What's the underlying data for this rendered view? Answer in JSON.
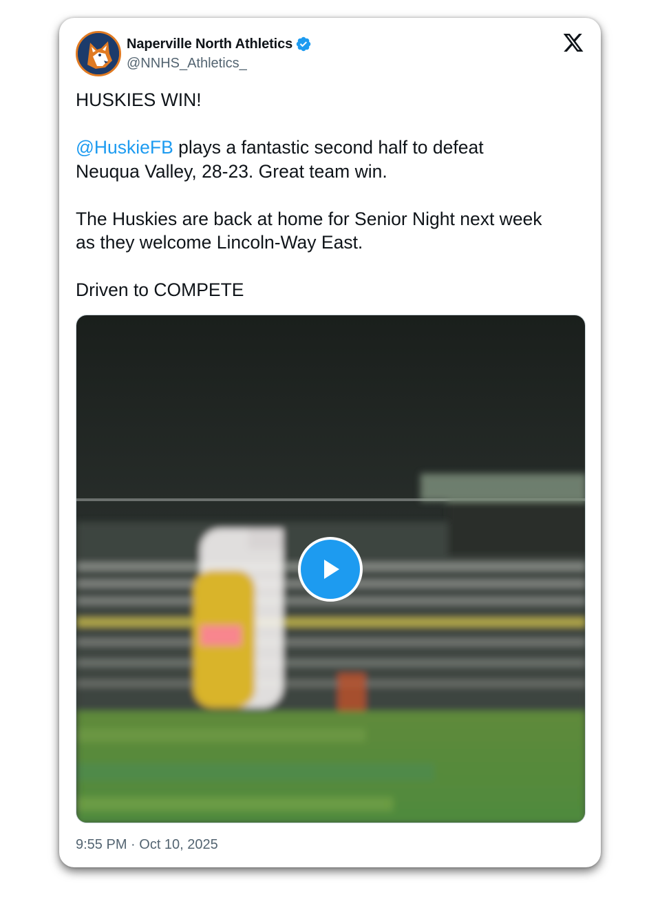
{
  "tweet": {
    "author": {
      "display_name": "Naperville North Athletics",
      "handle": "@NNHS_Athletics_",
      "verified": true,
      "avatar_icon": "husky-logo-icon"
    },
    "platform_icon": "x-logo-icon",
    "text": {
      "line1": "HUSKIES WIN!",
      "mention": "@HuskieFB",
      "para2_rest_a": " plays a fantastic second half to defeat",
      "para2_rest_b": "Neuqua Valley, 28-23. Great team win.",
      "para3_a": "The Huskies are back at home for Senior Night next week",
      "para3_b": "as they welcome Lincoln-Way East.",
      "para4": "Driven to COMPETE"
    },
    "media": {
      "type": "video",
      "play_icon": "play-icon"
    },
    "timestamp": "9:55 PM · Oct 10, 2025"
  },
  "colors": {
    "accent": "#1d9bf0",
    "text": "#0f1419",
    "secondary": "#536471",
    "avatar_bg": "#1c3b6b",
    "avatar_ring": "#e07a22"
  }
}
